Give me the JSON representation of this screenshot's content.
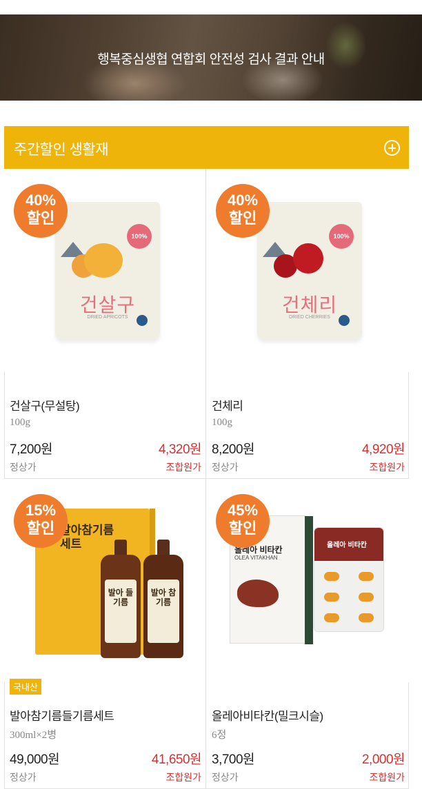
{
  "banner": {
    "text": "행복중심생협 연합회 안전성 검사 결과 안내"
  },
  "section": {
    "title": "주간할인 생활재",
    "more_icon": "plus-circle-icon"
  },
  "colors": {
    "accent": "#efb409",
    "badge": "#ef7b2c",
    "sale": "#d92f2f"
  },
  "products": [
    {
      "badge_pct": "40%",
      "badge_label": "할인",
      "package_text": "건살구",
      "package_sub": "DRIED APRICOTS",
      "package_tag": "100%",
      "name": "건살구(무설탕)",
      "spec": "100g",
      "price": "7,200원",
      "sale_price": "4,320원",
      "price_label": "정상가",
      "sale_label": "조합원가"
    },
    {
      "badge_pct": "40%",
      "badge_label": "할인",
      "package_text": "건체리",
      "package_sub": "DRIED CHERRIES",
      "package_tag": "100%",
      "name": "건체리",
      "spec": "100g",
      "price": "8,200원",
      "sale_price": "4,920원",
      "price_label": "정상가",
      "sale_label": "조합원가"
    },
    {
      "badge_pct": "15%",
      "badge_label": "할인",
      "package_text": "발아참기름 세트",
      "bottle1": "발아 들기름",
      "bottle2": "발아 참기름",
      "origin": "국내산",
      "name": "발아참기름들기름세트",
      "spec": "300ml×2병",
      "price": "49,000원",
      "sale_price": "41,650원",
      "price_label": "정상가",
      "sale_label": "조합원가"
    },
    {
      "badge_pct": "45%",
      "badge_label": "할인",
      "package_text": "올레아 비타칸",
      "package_sub": "OLEA VITAKHAN",
      "blister_text": "올레아 비타칸",
      "name": "올레아비타칸(밀크시슬)",
      "spec": "6정",
      "price": "3,700원",
      "sale_price": "2,000원",
      "price_label": "정상가",
      "sale_label": "조합원가"
    }
  ]
}
